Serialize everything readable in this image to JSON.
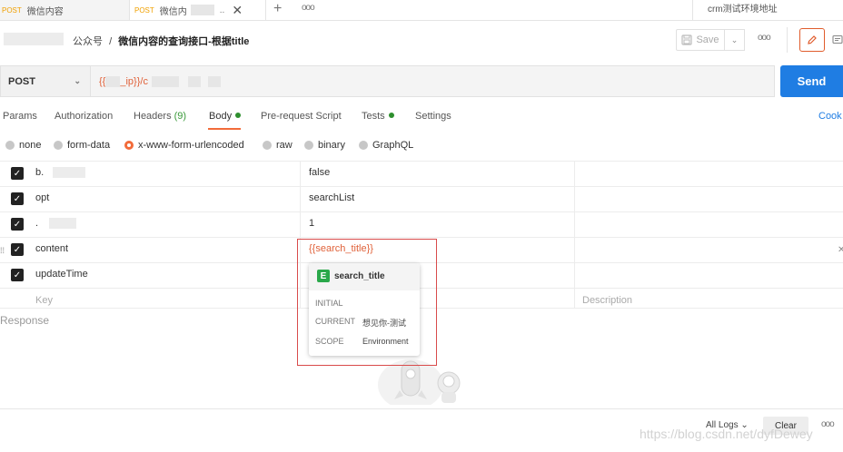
{
  "tabs": [
    {
      "method": "POST",
      "title": "微信内容"
    },
    {
      "method": "POST",
      "title": "微信内"
    }
  ],
  "tab_actions": {
    "new_tab": "+",
    "more": "ooo"
  },
  "environment": "crm测试环境地址",
  "breadcrumb": {
    "collection": "公众号",
    "separator": "/",
    "request_name": "微信内容的查询接口-根据title"
  },
  "toolbar": {
    "save_label": "Save",
    "more": "ooo"
  },
  "request": {
    "method": "POST",
    "url_prefix": "{{",
    "url_var": "_ip}}/c"
  },
  "send_label": "Send",
  "request_tabs": {
    "params": "Params",
    "authorization": "Authorization",
    "headers": "Headers",
    "headers_count": "(9)",
    "body": "Body",
    "prerequest": "Pre-request Script",
    "tests": "Tests",
    "settings": "Settings",
    "cookies": "Cook"
  },
  "body_types": {
    "none": "none",
    "form_data": "form-data",
    "urlencoded": "x-www-form-urlencoded",
    "raw": "raw",
    "binary": "binary",
    "graphql": "GraphQL"
  },
  "params": [
    {
      "key": "b.",
      "value": "false",
      "checked": true
    },
    {
      "key": "opt",
      "value": "searchList",
      "checked": true
    },
    {
      "key": ".",
      "value": "1",
      "checked": true
    },
    {
      "key": "content",
      "value": "{{search_title}}",
      "checked": true
    },
    {
      "key": "updateTime",
      "value": "",
      "checked": true
    }
  ],
  "placeholders": {
    "key": "Key",
    "description": "Description"
  },
  "response_label": "Response",
  "variable_popup": {
    "badge": "E",
    "name": "search_title",
    "initial_label": "INITIAL",
    "initial_value": "",
    "current_label": "CURRENT",
    "current_value": "想见你-测试",
    "scope_label": "SCOPE",
    "scope_value": "Environment"
  },
  "footer": {
    "all_logs": "All Logs",
    "clear": "Clear",
    "more": "ooo"
  },
  "watermark": "https://blog.csdn.net/dyfDewey",
  "colors": {
    "accent": "#f26b3a",
    "send": "#1f7de3",
    "variable": "#e0623a",
    "env_badge": "#2aa84a",
    "highlight": "#d94b4b"
  }
}
